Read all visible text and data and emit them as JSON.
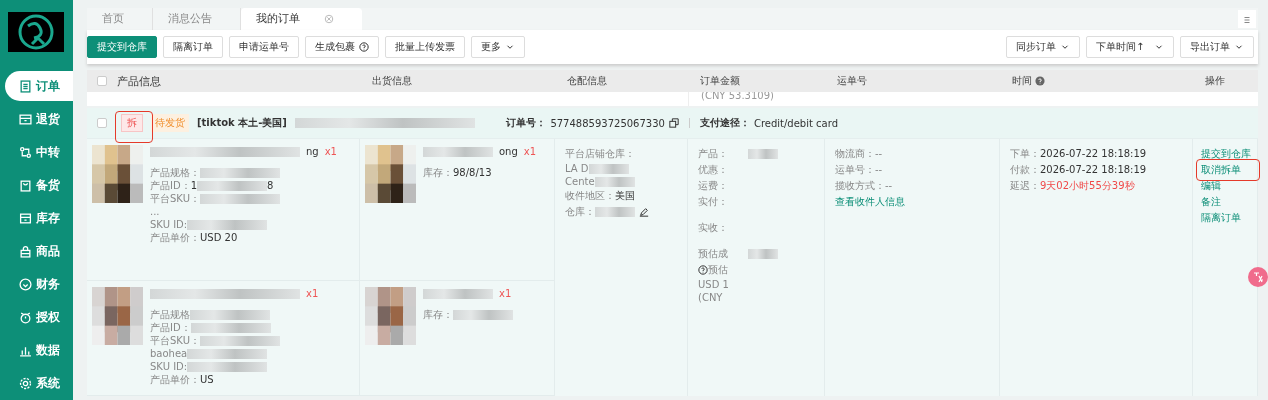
{
  "sidebar": {
    "items": [
      {
        "label": "订单",
        "selected": true
      },
      {
        "label": "退货",
        "selected": false
      },
      {
        "label": "中转",
        "selected": false
      },
      {
        "label": "备货",
        "selected": false
      },
      {
        "label": "库存",
        "selected": false
      },
      {
        "label": "商品",
        "selected": false
      },
      {
        "label": "财务",
        "selected": false
      },
      {
        "label": "授权",
        "selected": false
      },
      {
        "label": "数据",
        "selected": false
      },
      {
        "label": "系统",
        "selected": false
      }
    ]
  },
  "tabs": [
    {
      "label": "首页",
      "selected": false,
      "closable": false
    },
    {
      "label": "消息公告",
      "selected": false,
      "closable": false
    },
    {
      "label": "我的订单",
      "selected": true,
      "closable": true
    }
  ],
  "toolbar": {
    "left": [
      {
        "label": "提交到仓库",
        "kind": "primary"
      },
      {
        "label": "隔离订单",
        "kind": "plain"
      },
      {
        "label": "申请运单号",
        "kind": "plain"
      },
      {
        "label": "生成包裹",
        "kind": "help"
      },
      {
        "label": "批量上传发票",
        "kind": "plain"
      },
      {
        "label": "更多",
        "kind": "dropdown"
      }
    ],
    "right": [
      {
        "label": "同步订单",
        "kind": "dropdown"
      },
      {
        "label": "下单时间↑",
        "kind": "select"
      },
      {
        "label": "导出订单",
        "kind": "dropdown"
      }
    ]
  },
  "table": {
    "checked": false,
    "columns": [
      {
        "label": "产品信息",
        "help": false
      },
      {
        "label": "出货信息",
        "help": false
      },
      {
        "label": "仓配信息",
        "help": false
      },
      {
        "label": "订单金额",
        "help": false
      },
      {
        "label": "运单号",
        "help": false
      },
      {
        "label": "时间",
        "help": true
      },
      {
        "label": "操作",
        "help": false
      }
    ],
    "previous_row": {
      "amount": "(CNY 53.3109)"
    },
    "order": {
      "checked": false,
      "split_tag": "拆",
      "status": "待发货",
      "store": "[tiktok 本土-美国]",
      "order_no_label": "订单号：",
      "order_no": "577488593725067330",
      "pay_label": "支付途径：",
      "pay": "Credit/debit card",
      "products": [
        {
          "name_tail": "ng",
          "qty": "x1",
          "attributes": [
            {
              "label": "产品规格："
            },
            {
              "label": "产品ID：",
              "value": "1",
              "tail": "8"
            },
            {
              "label": "平台SKU："
            },
            {
              "label": "..."
            },
            {
              "label": "SKU ID:"
            },
            {
              "label": "产品单价：",
              "value": "USD 20"
            }
          ],
          "shipment": {
            "name_tail": "ong",
            "qty": "x1",
            "stock_label": "库存：",
            "stock": "98/8/13"
          }
        },
        {
          "qty": "x1",
          "attributes": [
            {
              "label": "产品规格"
            },
            {
              "label": "产品ID："
            },
            {
              "label": "平台SKU："
            },
            {
              "label": "baohea"
            },
            {
              "label": "SKU ID:"
            },
            {
              "label": "产品单价：",
              "value": "US"
            }
          ],
          "shipment": {
            "qty": "x1",
            "stock_label": "库存："
          }
        }
      ],
      "warehouse": [
        {
          "label": "平台店铺仓库：",
          "editable": false
        },
        {
          "label": "LA D",
          "editable": false
        },
        {
          "label": "Cente",
          "editable": false
        },
        {
          "label": "收件地区：",
          "value": "美国",
          "editable": false
        },
        {
          "label": "仓库：",
          "editable": true
        }
      ],
      "amount_groups": [
        {
          "lines": [
            {
              "label": "产品：",
              "help": false
            },
            {
              "label": "优惠：",
              "help": false
            },
            {
              "label": "运费：",
              "help": false
            },
            {
              "label": "实付：",
              "help": false
            }
          ]
        },
        {
          "lines": [
            {
              "label": "实收：",
              "help": false
            }
          ]
        },
        {
          "lines": [
            {
              "label": "预估成",
              "help": false
            },
            {
              "label": "预估",
              "help": true
            },
            {
              "label": "USD 1",
              "help": false
            },
            {
              "label": "(CNY",
              "help": false
            }
          ]
        }
      ],
      "tracking": [
        "物流商：--",
        "运单号：--",
        "揽收方式：--"
      ],
      "tracking_link": "查看收件人信息",
      "times": [
        {
          "label": "下单：",
          "value": "2026-07-22 18:18:19",
          "late": false
        },
        {
          "label": "付款：",
          "value": "2026-07-22 18:18:19",
          "late": false
        },
        {
          "label": "延迟：",
          "value": "9天02小时55分39秒",
          "late": true
        }
      ],
      "actions": [
        {
          "label": "提交到仓库",
          "highlighted": false
        },
        {
          "label": "取消拆单",
          "highlighted": true
        },
        {
          "label": "编辑",
          "highlighted": false
        },
        {
          "label": "备注",
          "highlighted": false
        },
        {
          "label": "隔离订单",
          "highlighted": false
        }
      ]
    }
  }
}
